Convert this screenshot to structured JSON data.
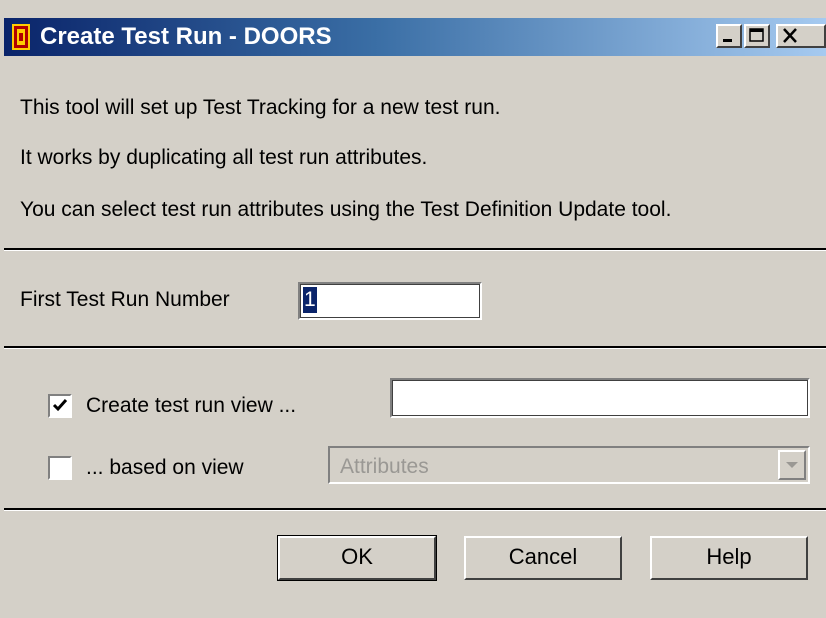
{
  "window": {
    "title": "Create Test Run - DOORS",
    "app_icon": "doors-app-icon",
    "controls": [
      "minimize-icon",
      "maximize-icon",
      "close-icon"
    ]
  },
  "intro": {
    "line1": "This tool will set up Test Tracking for a new test run.",
    "line2": "It works by duplicating all test run attributes.",
    "line3": "You can select test run attributes using the Test Definition Update tool."
  },
  "run_number": {
    "label": "First Test Run Number",
    "value": "1"
  },
  "create_view": {
    "label": "Create test run view ...",
    "checked": true,
    "value": ""
  },
  "based_on": {
    "label": "... based on view",
    "checked": false,
    "selected": "Attributes",
    "enabled": false
  },
  "buttons": {
    "ok": "OK",
    "cancel": "Cancel",
    "help": "Help"
  },
  "colors": {
    "title_start": "#0a246a",
    "title_end": "#a6caf0",
    "face": "#d4d0c8",
    "selection": "#0a246a"
  }
}
